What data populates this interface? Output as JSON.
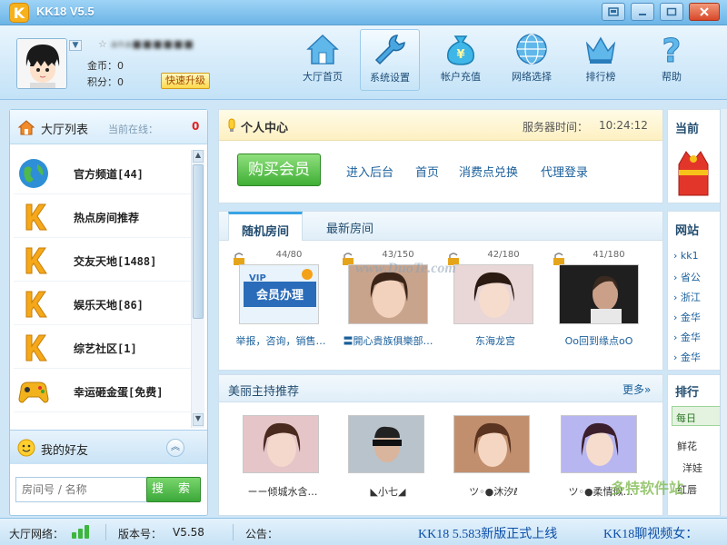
{
  "window": {
    "logo": "K",
    "title": "KK18 V5.5"
  },
  "user": {
    "avatar": "avatar-image",
    "name": "ana■■■■■■",
    "coins_label": "金币：",
    "coins": "0",
    "points_label": "积分：",
    "points": "0",
    "upgrade_label": "快速升级"
  },
  "nav": [
    {
      "label": "大厅首页",
      "icon": "home-icon"
    },
    {
      "label": "系统设置",
      "icon": "wrench-icon",
      "active": true
    },
    {
      "label": "帐户充值",
      "icon": "money-bag-icon"
    },
    {
      "label": "网络选择",
      "icon": "globe-icon"
    },
    {
      "label": "排行榜",
      "icon": "crown-icon"
    },
    {
      "label": "帮助",
      "icon": "question-icon"
    }
  ],
  "lobby": {
    "title": "大厅列表",
    "online_label": "当前在线：",
    "online_count": "0",
    "rooms": [
      {
        "label": "官方频道[44]",
        "icon": "globe-icon"
      },
      {
        "label": "热点房间推荐",
        "icon": "k-logo-icon"
      },
      {
        "label": "交友天地[1488]",
        "icon": "k-logo-icon"
      },
      {
        "label": "娱乐天地[86]",
        "icon": "k-logo-icon"
      },
      {
        "label": "综艺社区[1]",
        "icon": "k-logo-icon"
      },
      {
        "label": "幸运砸金蛋[免费]",
        "icon": "gamepad-icon"
      }
    ],
    "friends_label": "我的好友",
    "search_placeholder": "房间号 / 名称",
    "search_button": "搜 索"
  },
  "personal": {
    "title": "个人中心",
    "server_time_label": "服务器时间：",
    "server_time": "10:24:12",
    "buy_label": "购买会员",
    "links": [
      "进入后台",
      "首页",
      "消费点兑换",
      "代理登录"
    ]
  },
  "rooms_panel": {
    "tabs": [
      "随机房间",
      "最新房间"
    ],
    "cards": [
      {
        "count": "44/80",
        "name": "举报，咨询，销售…",
        "photo": "vip-banner"
      },
      {
        "count": "43/150",
        "name": "〓開心貴族俱樂部…",
        "photo": "girl-photo"
      },
      {
        "count": "42/180",
        "name": "东海龙宫",
        "photo": "girl-photo"
      },
      {
        "count": "41/180",
        "name": "Oo回到缘点oO",
        "photo": "man-photo"
      }
    ],
    "watermark": "www.DuoTe.com"
  },
  "hosts": {
    "title": "美丽主持推荐",
    "more": "更多»",
    "items": [
      {
        "name": "ーー倾城水含…"
      },
      {
        "name": "◣小七◢"
      },
      {
        "name": "ツ◦●沐汐ℓ"
      },
      {
        "name": "ツ◦●柔情似…"
      }
    ]
  },
  "right": {
    "box1_title": "当前",
    "box2_title": "网站",
    "links": [
      "› kk1",
      "› 省公",
      "› 浙江",
      "› 金华",
      "› 金华",
      "› 金华"
    ],
    "box3_title": "排行",
    "rank_tab": "每日",
    "rank_items": [
      "鲜花",
      "洋娃",
      "红唇"
    ]
  },
  "status": {
    "network_label": "大厅网络：",
    "version_label": "版本号：",
    "version": "V5.58",
    "notice_label": "公告：",
    "ticker1": "KK18 5.583新版正式上线",
    "ticker2": "KK18聊视频女："
  },
  "watermark_brand": "多特软件站"
}
